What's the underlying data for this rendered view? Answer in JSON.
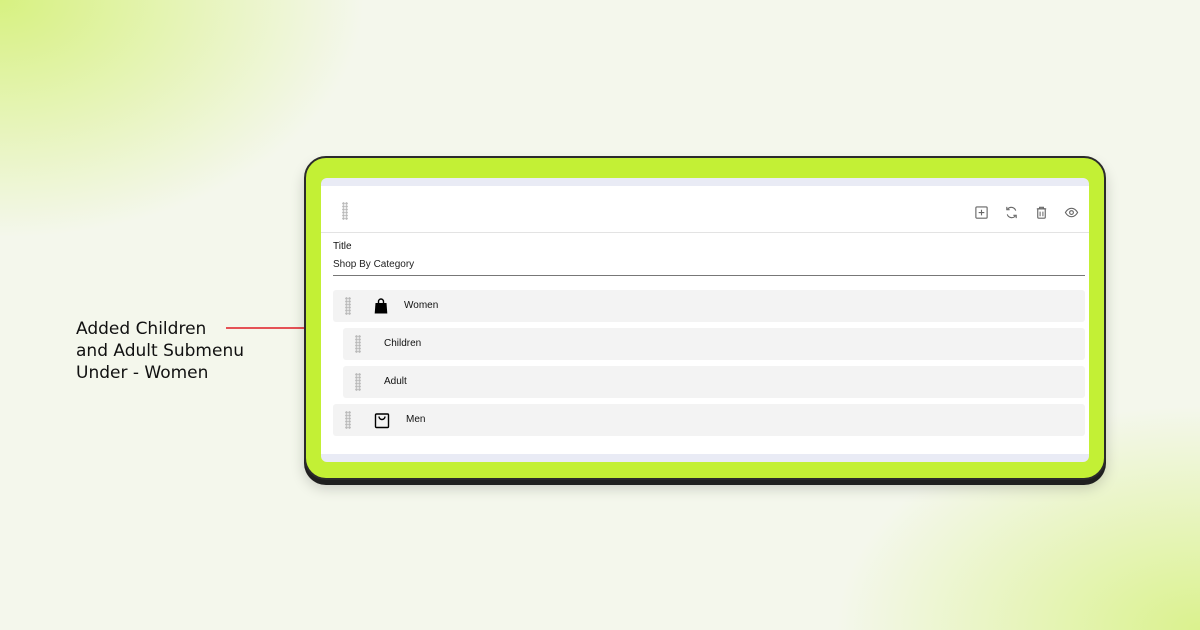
{
  "annotation": {
    "lines": [
      "Added Children",
      "and Adult Submenu",
      "Under - Women"
    ],
    "color": "#e01b24"
  },
  "header": {
    "actions": [
      "add-icon",
      "refresh-icon",
      "delete-icon",
      "view-icon"
    ]
  },
  "title_field": {
    "label": "Title",
    "value": "Shop By Category"
  },
  "menu": {
    "items": [
      {
        "label": "Women",
        "icon": "shopping-bag-filled-icon",
        "level": 0
      },
      {
        "label": "Children",
        "icon": "",
        "level": 1
      },
      {
        "label": "Adult",
        "icon": "",
        "level": 1
      },
      {
        "label": "Men",
        "icon": "shopping-bag-outline-icon",
        "level": 0
      }
    ]
  },
  "colors": {
    "frame": "#c3f035",
    "annotation_line": "#e01b24"
  }
}
